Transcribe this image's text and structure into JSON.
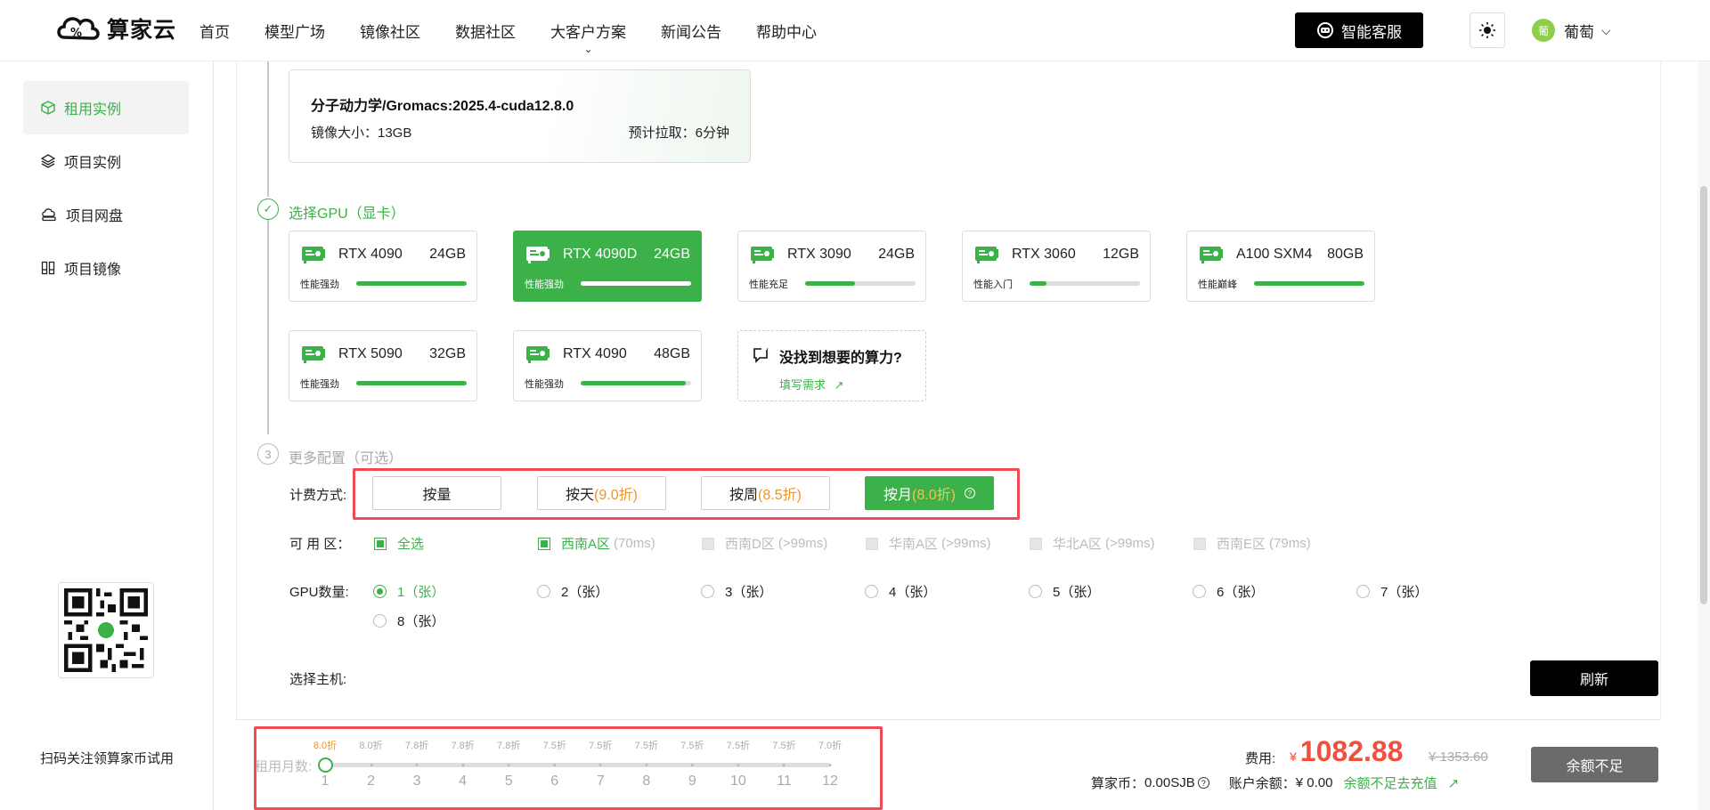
{
  "brand": {
    "name": "算家云"
  },
  "nav": {
    "items": [
      "首页",
      "模型广场",
      "镜像社区",
      "数据社区",
      "大客户方案",
      "新闻公告",
      "帮助中心"
    ]
  },
  "header": {
    "support_label": "智能客服",
    "user_name": "葡萄",
    "user_avatar": "葡"
  },
  "sidebar": {
    "items": [
      {
        "label": "租用实例",
        "icon": "cube-icon",
        "active": true
      },
      {
        "label": "项目实例",
        "icon": "layers-icon",
        "active": false
      },
      {
        "label": "项目网盘",
        "icon": "cloud-disk-icon",
        "active": false
      },
      {
        "label": "项目镜像",
        "icon": "image-stack-icon",
        "active": false
      }
    ],
    "qr_caption": "扫码关注领算家币试用"
  },
  "image_card": {
    "title": "分子动力学/Gromacs:2025.4-cuda12.8.0",
    "size_text": "镜像大小：13GB",
    "pull_text": "预计拉取：6分钟"
  },
  "gpu_section": {
    "title": "选择GPU（显卡）",
    "cards": [
      {
        "name": "RTX 4090",
        "mem": "24GB",
        "perf": "性能强劲",
        "level": 1.0,
        "selected": false
      },
      {
        "name": "RTX 4090D",
        "mem": "24GB",
        "perf": "性能强劲",
        "level": 1.0,
        "selected": true
      },
      {
        "name": "RTX 3090",
        "mem": "24GB",
        "perf": "性能充足",
        "level": 0.45,
        "selected": false
      },
      {
        "name": "RTX 3060",
        "mem": "12GB",
        "perf": "性能入门",
        "level": 0.15,
        "selected": false
      },
      {
        "name": "A100 SXM4",
        "mem": "80GB",
        "perf": "性能巅峰",
        "level": 1.0,
        "selected": false
      },
      {
        "name": "RTX 5090",
        "mem": "32GB",
        "perf": "性能强劲",
        "level": 1.0,
        "selected": false
      },
      {
        "name": "RTX 4090",
        "mem": "48GB",
        "perf": "性能强劲",
        "level": 0.95,
        "selected": false
      }
    ],
    "request": {
      "title": "没找到想要的算力?",
      "link": "填写需求"
    }
  },
  "more_config": {
    "step": "3",
    "title": "更多配置（可选）"
  },
  "billing": {
    "label": "计费方式:",
    "options": [
      {
        "label": "按量",
        "discount": "",
        "selected": false
      },
      {
        "label": "按天",
        "discount": "(9.0折)",
        "selected": false
      },
      {
        "label": "按周",
        "discount": "(8.5折)",
        "selected": false
      },
      {
        "label": "按月",
        "discount": "(8.0折)",
        "selected": true
      }
    ]
  },
  "zone": {
    "label": "可 用 区：",
    "options": [
      {
        "label": "全选",
        "latency": "",
        "state": "checked"
      },
      {
        "label": "西南A区",
        "latency": "(70ms)",
        "state": "checked"
      },
      {
        "label": "西南D区",
        "latency": "(>99ms)",
        "state": "disabled"
      },
      {
        "label": "华南A区",
        "latency": "(>99ms)",
        "state": "disabled"
      },
      {
        "label": "华北A区",
        "latency": "(>99ms)",
        "state": "disabled"
      },
      {
        "label": "西南E区",
        "latency": "(79ms)",
        "state": "disabled"
      }
    ]
  },
  "gpu_count": {
    "label": "GPU数量:",
    "options": [
      "1（张）",
      "2（张）",
      "3（张）",
      "4（张）",
      "5（张）",
      "6（张）",
      "7（张）",
      "8（张）"
    ],
    "selected_index": 0
  },
  "host": {
    "label": "选择主机:",
    "refresh_label": "刷新"
  },
  "rent_months": {
    "label": "租用月数:",
    "months": [
      "1",
      "2",
      "3",
      "4",
      "5",
      "6",
      "7",
      "8",
      "9",
      "10",
      "11",
      "12"
    ],
    "discounts": [
      "8.0折",
      "8.0折",
      "7.8折",
      "7.8折",
      "7.8折",
      "7.5折",
      "7.5折",
      "7.5折",
      "7.5折",
      "7.5折",
      "7.5折",
      "7.0折"
    ],
    "selected": "1"
  },
  "price": {
    "fee_label": "费用:",
    "currency": "¥",
    "amount": "1082.88",
    "original": "¥ 1353.60",
    "coin_label": "算家币：",
    "coin_value": "0.00SJB",
    "balance_label": "账户余额：",
    "balance_value": "¥ 0.00",
    "recharge_link": "余额不足去充值",
    "submit_label": "余额不足"
  },
  "colors": {
    "accent": "#3cb14a",
    "price": "#f0503c",
    "discount": "#f29423",
    "highlight_box": "#f04a55"
  }
}
